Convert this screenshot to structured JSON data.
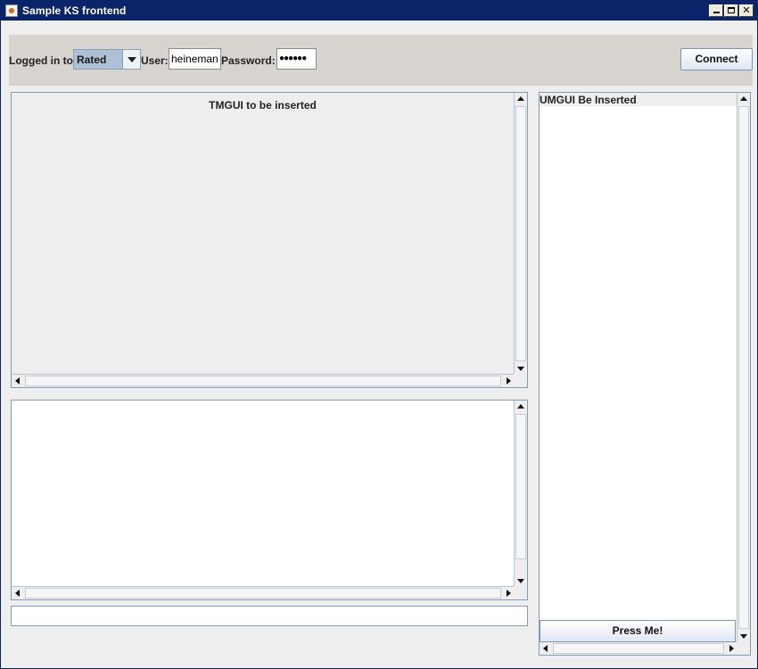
{
  "window": {
    "title": "Sample KS frontend",
    "minimize_icon": "minimize-icon",
    "maximize_icon": "maximize-icon",
    "close_icon": "close-icon",
    "close_glyph": "✕"
  },
  "toolbar": {
    "logged_in_label": "Logged in to:",
    "server_selected": "Rated",
    "user_label": "User:",
    "user_value": "heineman",
    "password_label": "Password:",
    "password_value": "●●●●●●",
    "connect_label": "Connect"
  },
  "tmgui": {
    "label": "TMGUI to be inserted"
  },
  "output": {
    "text": ""
  },
  "command": {
    "value": ""
  },
  "umgui": {
    "label": "UMGUI Be Inserted",
    "press_label": "Press Me!"
  },
  "colors": {
    "titlebar": "#0a246a",
    "toolbar_bg": "#d7d4cf",
    "combo_selected": "#aec0d6",
    "border": "#7f9db9"
  }
}
